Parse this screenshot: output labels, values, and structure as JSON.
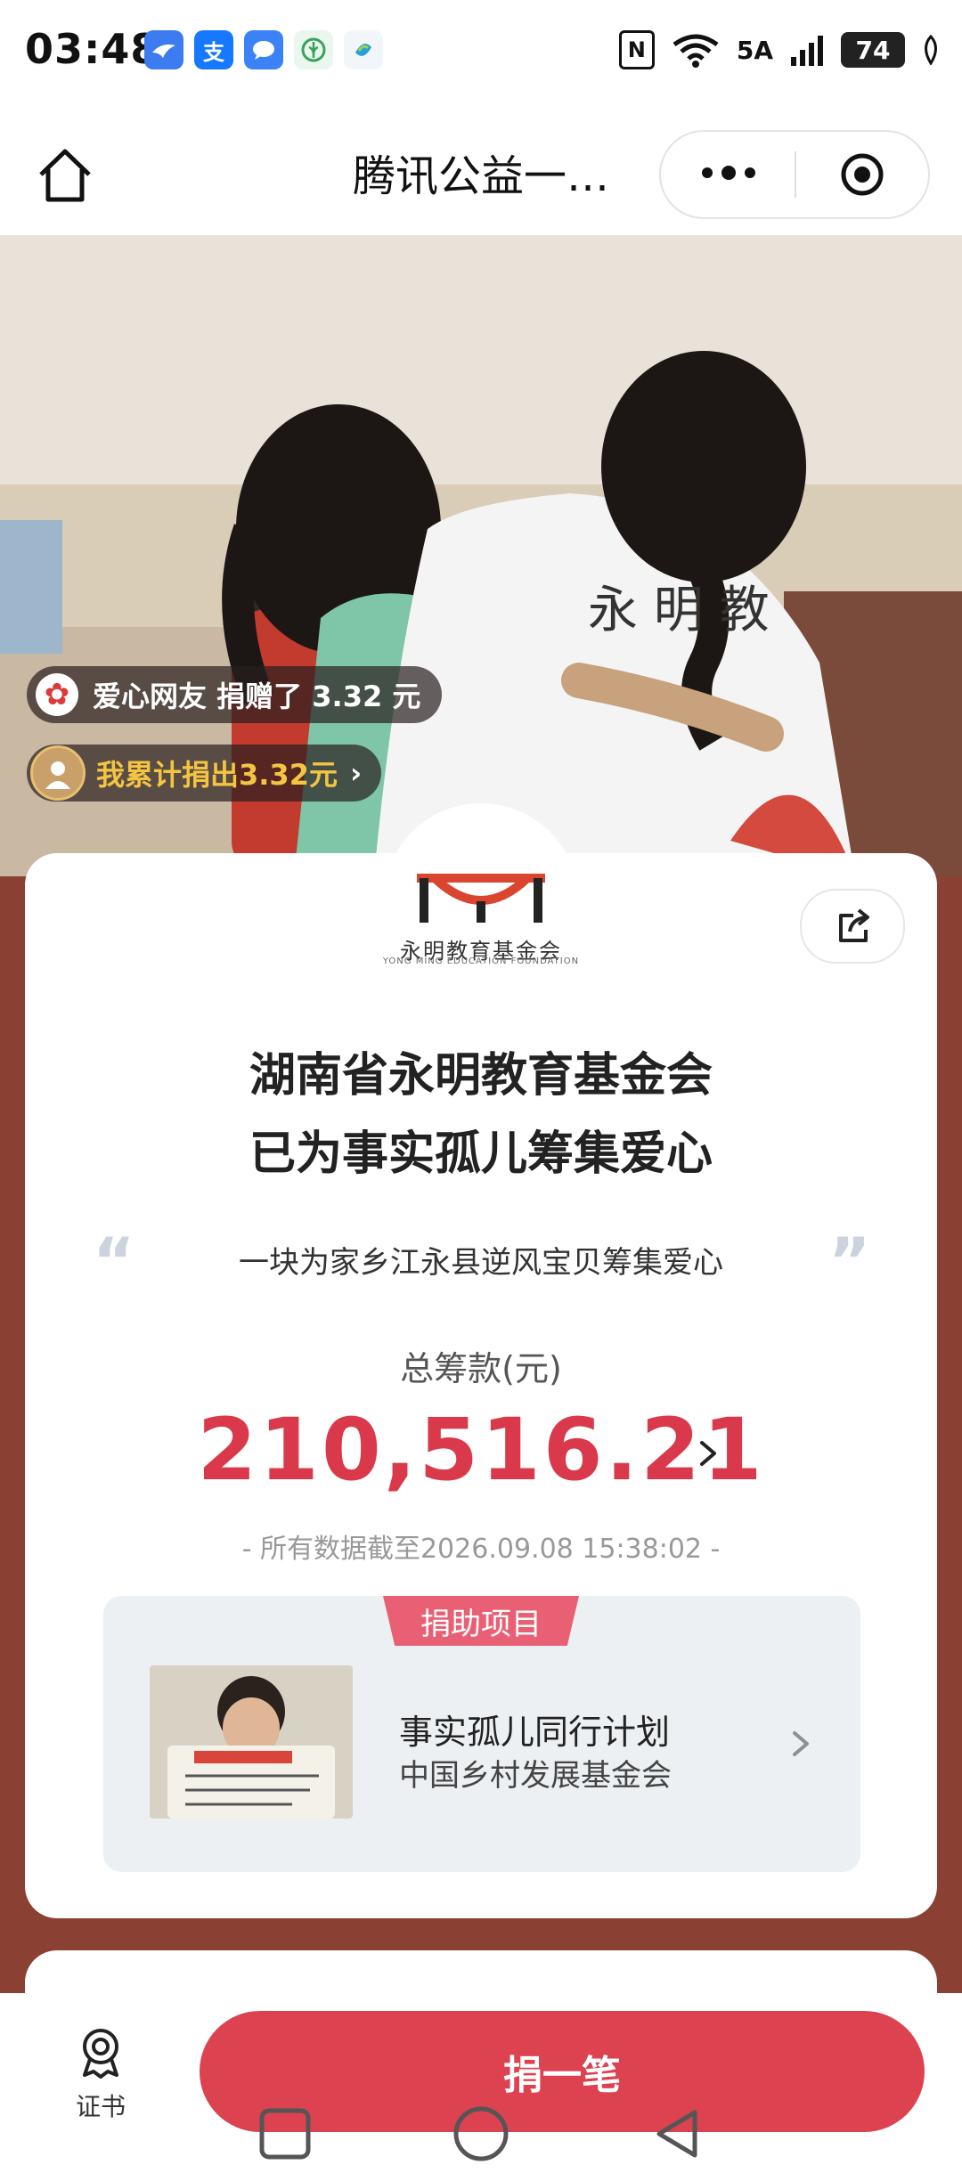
{
  "status_bar": {
    "time": "03:48",
    "signal_label": "5A",
    "battery": "74",
    "nfc_label": "N",
    "apps": [
      "bird-app-icon",
      "alipay-icon",
      "message-icon",
      "plant-app-icon",
      "china-mobile-icon"
    ],
    "alipay_glyph": "支"
  },
  "header": {
    "title": "腾讯公益一…"
  },
  "hero": {
    "donation_ticker": "爱心网友 捐赠了 3.32 元",
    "my_total": "我累计捐出3.32元",
    "my_total_chevron": "›"
  },
  "foundation": {
    "logo_cn": "永明教育基金会",
    "logo_en": "YONG MING EDUCATION FOUNDATION",
    "logo_color": "#d9452e"
  },
  "summary": {
    "headline_line1": "湖南省永明教育基金会",
    "headline_line2": "已为事实孤儿筹集爱心",
    "quote_open": "“",
    "quote_close": "”",
    "slogan": "一块为家乡江永县逆风宝贝筹集爱心",
    "total_label": "总筹款(元)",
    "total_amount": "210,516.21",
    "data_note": "- 所有数据截至2026.09.08 15:38:02 -"
  },
  "project": {
    "tag": "捐助项目",
    "name": "事实孤儿同行计划",
    "org": "中国乡村发展基金会"
  },
  "bottom": {
    "certificate_label": "证书",
    "donate_label": "捐一笔"
  },
  "colors": {
    "accent_red": "#d9394a",
    "button_red": "#dc4250",
    "page_bg": "#8a4032"
  }
}
